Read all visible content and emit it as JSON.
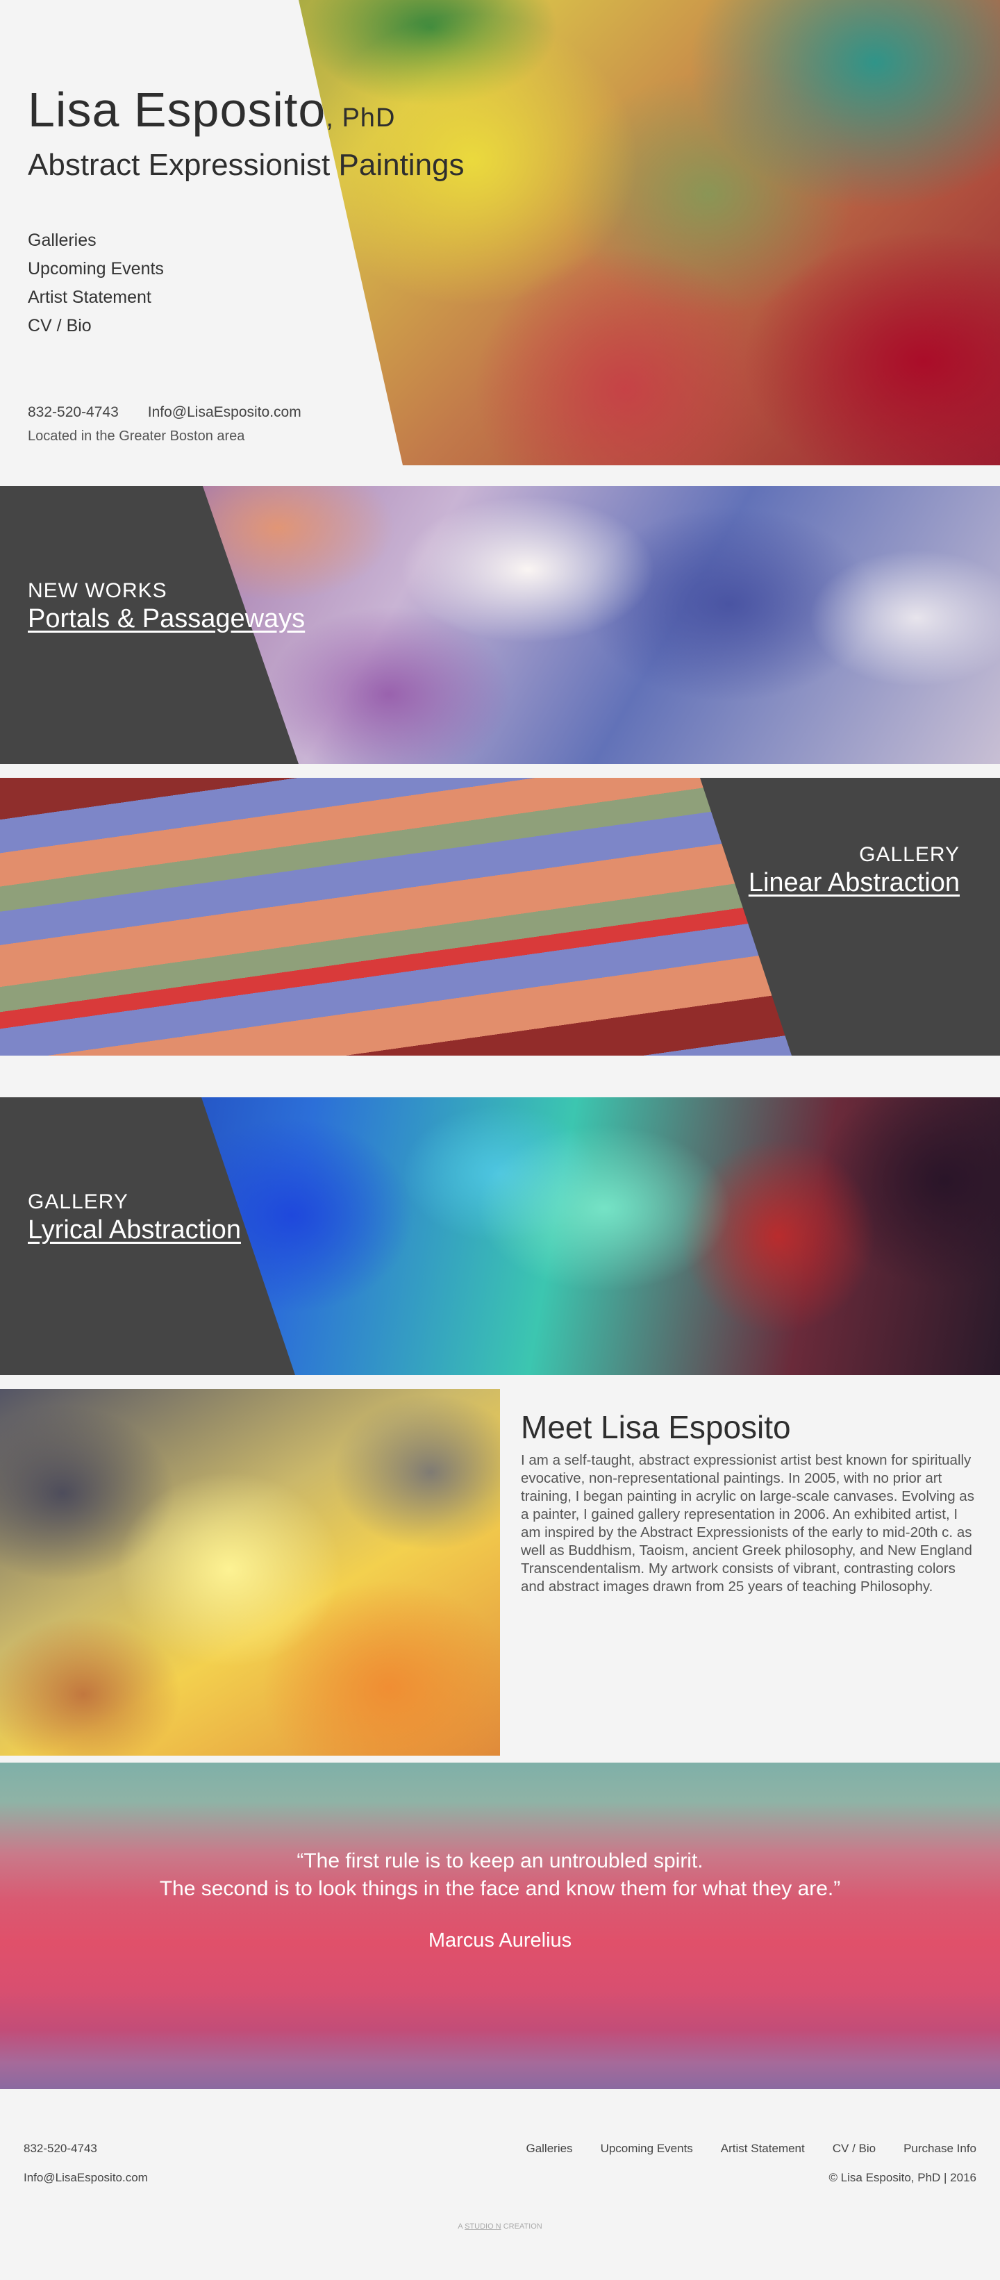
{
  "hero": {
    "name": "Lisa Esposito",
    "name_suffix": ", PhD",
    "subtitle": "Abstract Expressionist Paintings",
    "nav": [
      "Galleries",
      "Upcoming Events",
      "Artist Statement",
      "CV / Bio"
    ],
    "phone": "832-520-4743",
    "email": "Info@LisaEsposito.com",
    "location": "Located in the Greater Boston area"
  },
  "bands": [
    {
      "kicker": "NEW WORKS",
      "link": "Portals & Passageways"
    },
    {
      "kicker": "GALLERY",
      "link": "Linear Abstraction"
    },
    {
      "kicker": "GALLERY",
      "link": "Lyrical Abstraction"
    }
  ],
  "about": {
    "title": "Meet Lisa Esposito",
    "body": "I am a self-taught, abstract expressionist artist best known for spiritually evocative, non-representational paintings. In 2005, with no prior art training, I began painting in acrylic on large-scale canvases. Evolving as a painter, I gained gallery representation in 2006. An exhibited artist, I am inspired by the Abstract Expressionists of the early to mid-20th c. as well as Buddhism, Taoism, ancient Greek philosophy, and New England Transcendentalism. My artwork consists of vibrant, contrasting colors and abstract images drawn from 25 years of teaching Philosophy."
  },
  "quote": {
    "line1": "“The first rule is to keep an untroubled spirit.",
    "line2": "The second is to look things in the face and know them for what they are.”",
    "author": "Marcus Aurelius"
  },
  "footer": {
    "phone": "832-520-4743",
    "email": "Info@LisaEsposito.com",
    "nav": [
      "Galleries",
      "Upcoming Events",
      "Artist Statement",
      "CV / Bio",
      "Purchase Info"
    ],
    "copyright": "© Lisa Esposito, PhD | 2016",
    "credit_prefix": "A",
    "credit_studio": "STUDIO N",
    "credit_suffix": "CREATION"
  }
}
